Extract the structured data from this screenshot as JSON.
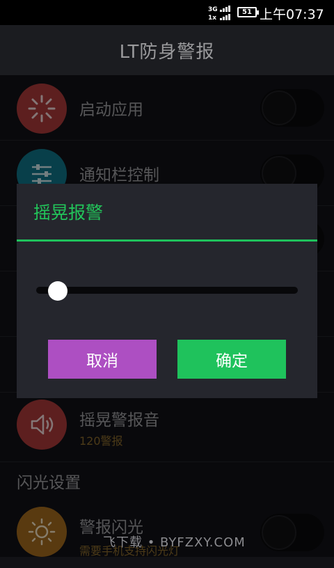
{
  "status_bar": {
    "network": "3G",
    "network2": "1x",
    "battery": "51",
    "time": "上午07:37"
  },
  "app": {
    "title": "LT防身警报"
  },
  "rows": [
    {
      "label": "启动应用",
      "icon": "loading-icon",
      "color": "#a93a3a",
      "toggle": false
    },
    {
      "label": "通知栏控制",
      "icon": "sliders-icon",
      "color": "#0f7487",
      "toggle": false
    },
    {
      "label": "摇晃警报音",
      "sub": "120警报",
      "icon": "speaker-icon",
      "color": "#a93a3a"
    },
    {
      "label": "警报闪光",
      "sub": "需要手机支持闪光灯",
      "icon": "sun-icon",
      "color": "#a26a1e",
      "toggle": false
    }
  ],
  "section": {
    "flash_title": "闪光设置"
  },
  "watermark": "飞下载 • BYFZXY.COM",
  "dialog": {
    "title": "摇晃报警",
    "slider_fraction": 0.05,
    "cancel": "取消",
    "ok": "确定"
  }
}
